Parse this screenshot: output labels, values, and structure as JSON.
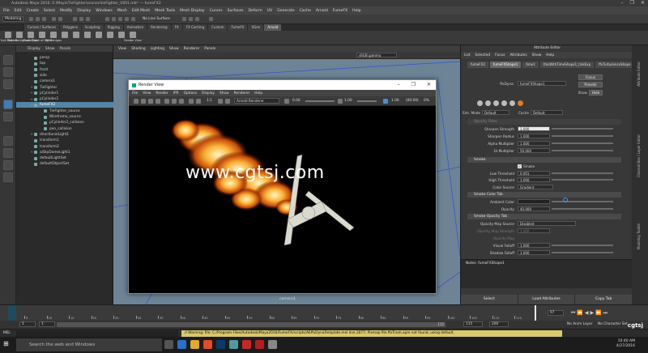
{
  "window": {
    "title": "Autodesk Maya 2016: E:\\Maya\\TieFighter\\scenes\\tieFighter_V001.mb* --- fumeFX2",
    "controls": [
      "–",
      "❐",
      "✕"
    ]
  },
  "menubar": [
    "File",
    "Edit",
    "Create",
    "Select",
    "Modify",
    "Display",
    "Windows",
    "Mesh",
    "Edit Mesh",
    "Mesh Tools",
    "Mesh Display",
    "Curves",
    "Surfaces",
    "Deform",
    "UV",
    "Generate",
    "Cache",
    "Arnold",
    "FumeFX",
    "Help"
  ],
  "statusline": {
    "mode": "Modeling",
    "live_surface": "No Live Surface"
  },
  "shelf_tabs": [
    "Curves / Surfaces",
    "Polygons",
    "Sculpting",
    "Rigging",
    "Animation",
    "Rendering",
    "FX",
    "FX Caching",
    "Custom",
    "FumeFX",
    "XGen",
    "Arnold"
  ],
  "shelf_active": "Arnold",
  "shelf_buttons": [
    "Flush Texture",
    "Flush Background",
    "Flush Quad",
    "Flush all lights",
    "TX Manager",
    "",
    "",
    "",
    "",
    "",
    "",
    "Render View"
  ],
  "outliner": {
    "menu": [
      "Display",
      "Show",
      "Panels"
    ],
    "items": [
      {
        "label": "persp",
        "indent": 1,
        "expand": ""
      },
      {
        "label": "top",
        "indent": 1,
        "expand": ""
      },
      {
        "label": "front",
        "indent": 1,
        "expand": ""
      },
      {
        "label": "side",
        "indent": 1,
        "expand": ""
      },
      {
        "label": "camera1",
        "indent": 1,
        "expand": ""
      },
      {
        "label": "TieFighter",
        "indent": 1,
        "expand": "+"
      },
      {
        "label": "pCylinder1",
        "indent": 1,
        "expand": "+"
      },
      {
        "label": "pCylinder2",
        "indent": 1,
        "expand": "+"
      },
      {
        "label": "fumeFX2",
        "indent": 1,
        "expand": "+",
        "selected": true
      },
      {
        "label": "TieFighter_source",
        "indent": 2,
        "expand": ""
      },
      {
        "label": "Wireframe_source",
        "indent": 2,
        "expand": ""
      },
      {
        "label": "pCylinder2_collision",
        "indent": 2,
        "expand": ""
      },
      {
        "label": "pen_collision",
        "indent": 2,
        "expand": ""
      },
      {
        "label": "directionalLight1",
        "indent": 1,
        "expand": "+"
      },
      {
        "label": "transform1",
        "indent": 1,
        "expand": ""
      },
      {
        "label": "transform2",
        "indent": 1,
        "expand": ""
      },
      {
        "label": "aiSkyDomeLight1",
        "indent": 1,
        "expand": "+"
      },
      {
        "label": "defaultLightSet",
        "indent": 1,
        "expand": ""
      },
      {
        "label": "defaultObjectSet",
        "indent": 1,
        "expand": ""
      }
    ]
  },
  "viewport": {
    "menu": [
      "View",
      "Shading",
      "Lighting",
      "Show",
      "Renderer",
      "Panels"
    ],
    "gamma": "sRGB gamma",
    "camera": "camera1"
  },
  "render_view": {
    "title": "Render View",
    "menu": [
      "File",
      "View",
      "Render",
      "IPR",
      "Options",
      "Display",
      "Show",
      "Renderer",
      "Help"
    ],
    "ratio": "1:1",
    "renderer": "Arnold Renderer",
    "exposure": "0.00",
    "gamma": "1.00",
    "zoom": "1.00",
    "time": "(00:00)",
    "fps": "0%"
  },
  "watermark": "www.cgtsj.com",
  "attribute_editor": {
    "menu": [
      "List",
      "Selected",
      "Focus",
      "Attributes",
      "Show",
      "Help"
    ],
    "panel_title": "Attribute Editor",
    "tabs": [
      "fumeFX2",
      "fumeFXShape1",
      "time1",
      "thisWithTimeShape1_tinkExp",
      "ffxTurbulenceShape"
    ],
    "node_label": "ffxDyna:",
    "node_value": "fumeFXShape1",
    "focus_btn": "Focus",
    "presets_btn": "Presets",
    "show_label": "Show",
    "hide_btn": "Hide",
    "sim_mode_label": "Sim. Mode",
    "sim_mode_value": "Default",
    "cache_label": "Cache",
    "cache_value": "Default",
    "section_opacity_faded": "Opacity Filter",
    "fields": [
      {
        "label": "Sharpen Strength",
        "value": "1.000",
        "highlight": true
      },
      {
        "label": "Sharpen Radius",
        "value": "1.000"
      },
      {
        "label": "Alpha Multiplier",
        "value": "1.000"
      },
      {
        "label": "GI Multiplier",
        "value": "50.000"
      }
    ],
    "section_smoke": "Smoke",
    "smoke_check_label": "Smoke",
    "smoke_fields": [
      {
        "label": "Low Threshold",
        "value": "0.001"
      },
      {
        "label": "High Threshold",
        "value": "1.000"
      }
    ],
    "color_source_label": "Color Source",
    "color_source_value": "Gradient",
    "section_smoke_color": "Smoke Color Tab",
    "ambient_color_label": "Ambient Color",
    "opacity_label": "Opacity",
    "opacity_value": "40.000",
    "section_smoke_opacity": "Smoke Opacity Tab",
    "opacity_map_label": "Opacity Map Source",
    "opacity_map_value": "Disabled",
    "faded_rows": [
      "Opacity Map Strength",
      "Opacity Map"
    ],
    "faded_value": "1.000",
    "visual_falloff_label": "Visual Falloff",
    "visual_falloff_value": "1.000",
    "shadow_falloff_label": "Shadow Falloff",
    "shadow_falloff_value": "1.000",
    "notes_label": "Notes: fumeFXShape1",
    "bottom_buttons": [
      "Select",
      "Load Attributes",
      "Copy Tab"
    ]
  },
  "right_sidebar": [
    "Attribute Editor",
    "Channel Box / Layer Editor",
    "Modeling Toolkit"
  ],
  "timeline": {
    "ticks": [
      "5",
      "10",
      "15",
      "20",
      "25",
      "30",
      "35",
      "40",
      "45",
      "50",
      "55",
      "60",
      "65",
      "70",
      "75",
      "80",
      "85",
      "90",
      "95",
      "100",
      "105",
      "110",
      "115"
    ],
    "current": "97"
  },
  "range": {
    "start": "1",
    "playback_start": "1",
    "playback_end": "115",
    "range_marker": "115",
    "end": "200",
    "frame_rate_label": "No Anim Layer",
    "character": "No Character Set"
  },
  "mel": {
    "label": "MEL",
    "warning": "// Warning: file: C:/Program Files/Autodesk/Maya2016/FumeFX/scripts/AEffxDynaTemplate.mel line 2077: Pixmap file ffxTrash.xpm not found, using default."
  },
  "taskbar": {
    "search": "Search the web and Windows",
    "time": "10:40 AM",
    "date": "4/27/2016"
  },
  "corner_logo": "cgtsj",
  "colors": {
    "accent": "#5285a6",
    "warning_bg": "#d9c96b",
    "viewport_bg": "#6c8496"
  }
}
